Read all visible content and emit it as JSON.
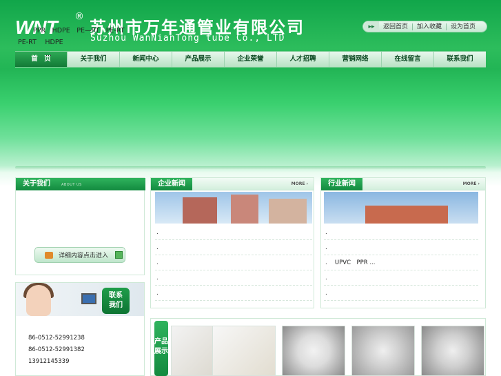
{
  "header": {
    "logo_text": "WNT",
    "registered": "®",
    "company_cn": "苏州市万年通管业有限公司",
    "company_en": "Suzhou WanNianTong tube Co., LTD"
  },
  "toplinks": {
    "arrow": "▸▸",
    "items": [
      "返回首页",
      "加入收藏",
      "设为首页"
    ]
  },
  "nav": {
    "items": [
      "首　页",
      "关于我们",
      "新闻中心",
      "产品展示",
      "企业荣誉",
      "人才招聘",
      "营销网络",
      "在线留言",
      "联系我们"
    ]
  },
  "about": {
    "title": "关于我们",
    "subtitle": "ABOUT US",
    "line1": "PPR　HDPE　PE—RT　PE-RT",
    "line2": "PE-RT　 HDPE",
    "line3": "...",
    "detail_button": "详细内容点击进入"
  },
  "contact": {
    "badge_line1": "联系",
    "badge_line2": "我们",
    "phone1": "86-0512-52991238",
    "phone2": "86-0512-52991382",
    "mobile": "13912145339"
  },
  "company_news": {
    "title": "企业新闻",
    "more": "MORE ›",
    "items": [
      ".",
      ".",
      ".",
      ".",
      "."
    ]
  },
  "industry_news": {
    "title": "行业新闻",
    "more": "MORE ›",
    "items": [
      ".",
      ".",
      ".　 UPVC　PPR ...",
      ".",
      "."
    ]
  },
  "products": {
    "title": "产品展示"
  },
  "colors": {
    "brand_green": "#138a3f",
    "header_green": "#11a64a"
  }
}
